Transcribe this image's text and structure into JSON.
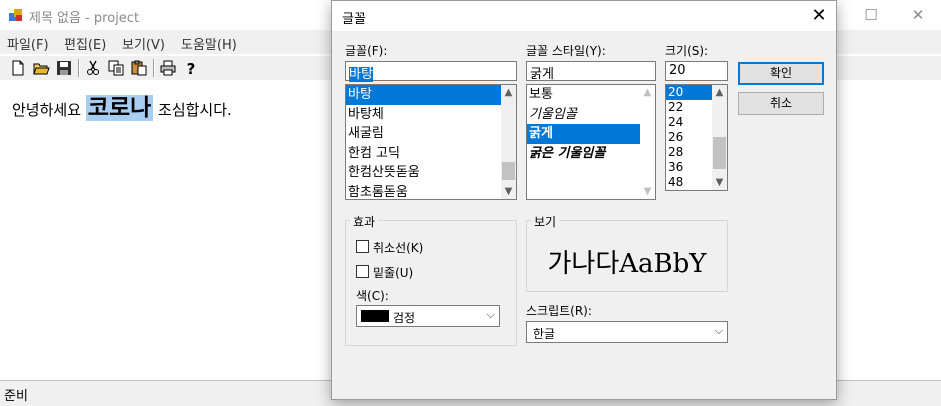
{
  "app": {
    "title": "제목 없음 - project",
    "window_buttons": {
      "minimize": "—",
      "maximize": "☐",
      "close": "✕"
    }
  },
  "menu": [
    "파일(F)",
    "편집(E)",
    "보기(V)",
    "도움말(H)"
  ],
  "toolbar_icons": [
    "new-file-icon",
    "open-folder-icon",
    "save-icon",
    "cut-icon",
    "copy-icon",
    "paste-icon",
    "print-icon",
    "help-icon"
  ],
  "document": {
    "before": "안녕하세요 ",
    "selected": "코로나",
    "after": " 조심합시다."
  },
  "status": "준비",
  "dialog": {
    "title": "글꼴",
    "close": "✕",
    "font_label": "글꼴(F):",
    "font_value": "바탕",
    "font_list": [
      "바탕",
      "바탕체",
      "새굴림",
      "한컴 고딕",
      "한컴산뜻돋움",
      "함초롬돋움"
    ],
    "font_selected_index": 0,
    "style_label": "글꼴 스타일(Y):",
    "style_value": "굵게",
    "style_list": [
      "보통",
      "기울임꼴",
      "굵게",
      "굵은 기울임꼴"
    ],
    "style_selected_index": 2,
    "size_label": "크기(S):",
    "size_value": "20",
    "size_list": [
      "20",
      "22",
      "24",
      "26",
      "28",
      "36",
      "48"
    ],
    "size_selected_index": 0,
    "ok": "확인",
    "cancel": "취소",
    "effects_label": "효과",
    "strikeout": "취소선(K)",
    "underline": "밑줄(U)",
    "strikeout_checked": false,
    "underline_checked": false,
    "color_label": "색(C):",
    "color_value": "검정",
    "color_swatch": "#000000",
    "preview_label": "보기",
    "preview_text": "가나다AaBbY",
    "script_label": "스크립트(R):",
    "script_value": "한글"
  },
  "colors": {
    "selection": "#0078d7",
    "doc_highlight": "#a8cdf0"
  }
}
